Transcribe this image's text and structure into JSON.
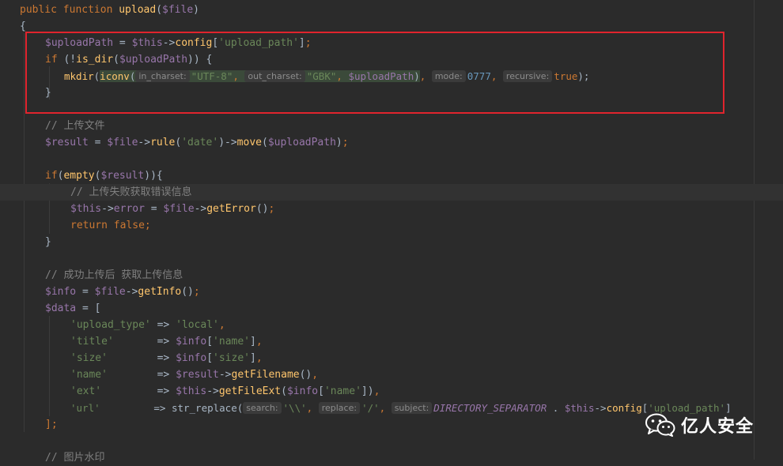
{
  "watermark": {
    "text": "亿人安全",
    "icon": "wechat-icon"
  },
  "code": {
    "l1": {
      "kw": "public function ",
      "fn": "upload",
      "p1": "(",
      "var": "$file",
      "p2": ")"
    },
    "l2": {
      "t": "{"
    },
    "l3": {
      "v1": "$uploadPath",
      "p1": " = ",
      "v2": "$this",
      "p2": "->",
      "m": "config",
      "p3": "[",
      "s": "'upload_path'",
      "p4": "]",
      "k": ";"
    },
    "l4": {
      "kw": "if ",
      "p1": "(!",
      "fn": "is_dir",
      "p2": "(",
      "v": "$uploadPath",
      "p3": ")) {"
    },
    "l5": {
      "fn": "mkdir",
      "p1": "(",
      "fn2": "iconv",
      "p2": "(",
      "h1": "in_charset:",
      "s1": "\"UTF-8\"",
      "c1": ", ",
      "h2": "out_charset:",
      "s2": "\"GBK\"",
      "c2": ", ",
      "v": "$uploadPath",
      "p3": ")",
      "c3": ", ",
      "h3": "mode:",
      "n": "0777",
      "c4": ", ",
      "h4": "recursive:",
      "kw": "true",
      "p4": ");"
    },
    "l6": {
      "t": "}"
    },
    "l7": {
      "c": "// 上传文件"
    },
    "l8": {
      "v1": "$result",
      "p1": " = ",
      "v2": "$file",
      "p2": "->",
      "m1": "rule",
      "p3": "(",
      "s": "'date'",
      "p4": ")->",
      "m2": "move",
      "p5": "(",
      "v3": "$uploadPath",
      "p6": ")",
      "k": ";"
    },
    "l9": {
      "kw": "if",
      "p1": "(",
      "fn": "empty",
      "p2": "(",
      "v": "$result",
      "p3": ")){"
    },
    "l10": {
      "c": "// 上传失败获取错误信息"
    },
    "l11": {
      "v1": "$this",
      "p1": "->",
      "v2": "error",
      "p2": " = ",
      "v3": "$file",
      "p3": "->",
      "m": "getError",
      "p4": "()",
      "k": ";"
    },
    "l12": {
      "kw": "return false",
      "k": ";"
    },
    "l13": {
      "t": "}"
    },
    "l14": {
      "c": "// 成功上传后 获取上传信息"
    },
    "l15": {
      "v1": "$info",
      "p1": " = ",
      "v2": "$file",
      "p2": "->",
      "m": "getInfo",
      "p3": "()",
      "k": ";"
    },
    "l16": {
      "v": "$data",
      "p": " = ["
    },
    "l17": {
      "s1": "'upload_type'",
      "p1": " => ",
      "s2": "'local'",
      "k": ","
    },
    "l18": {
      "s1": "'title'",
      "p1": "       => ",
      "v": "$info",
      "p2": "[",
      "s2": "'name'",
      "p3": "]",
      "k": ","
    },
    "l19": {
      "s1": "'size'",
      "p1": "        => ",
      "v": "$info",
      "p2": "[",
      "s2": "'size'",
      "p3": "]",
      "k": ","
    },
    "l20": {
      "s1": "'name'",
      "p1": "        => ",
      "v": "$result",
      "p2": "->",
      "m": "getFilename",
      "p3": "()",
      "k": ","
    },
    "l21": {
      "s1": "'ext'",
      "p1": "         => ",
      "v1": "$this",
      "p2": "->",
      "m": "getFileExt",
      "p3": "(",
      "v2": "$info",
      "p4": "[",
      "s2": "'name'",
      "p5": "])",
      "k": ","
    },
    "l22": {
      "s1": "'url'",
      "p1": "         => ",
      "fn": "str_replace",
      "p2": "(",
      "h1": "search:",
      "s2": "'\\\\'",
      "c1": ", ",
      "h2": "replace:",
      "s3": "'/'",
      "c2": ", ",
      "h3": "subject:",
      "const": "DIRECTORY_SEPARATOR",
      "p3": " . ",
      "v": "$this",
      "p4": "->",
      "m": "config",
      "p5": "[",
      "s4": "'upload_path'",
      "p6": "]"
    },
    "l23": {
      "t": "];"
    },
    "l24": {
      "c": "// 图片水印"
    }
  }
}
